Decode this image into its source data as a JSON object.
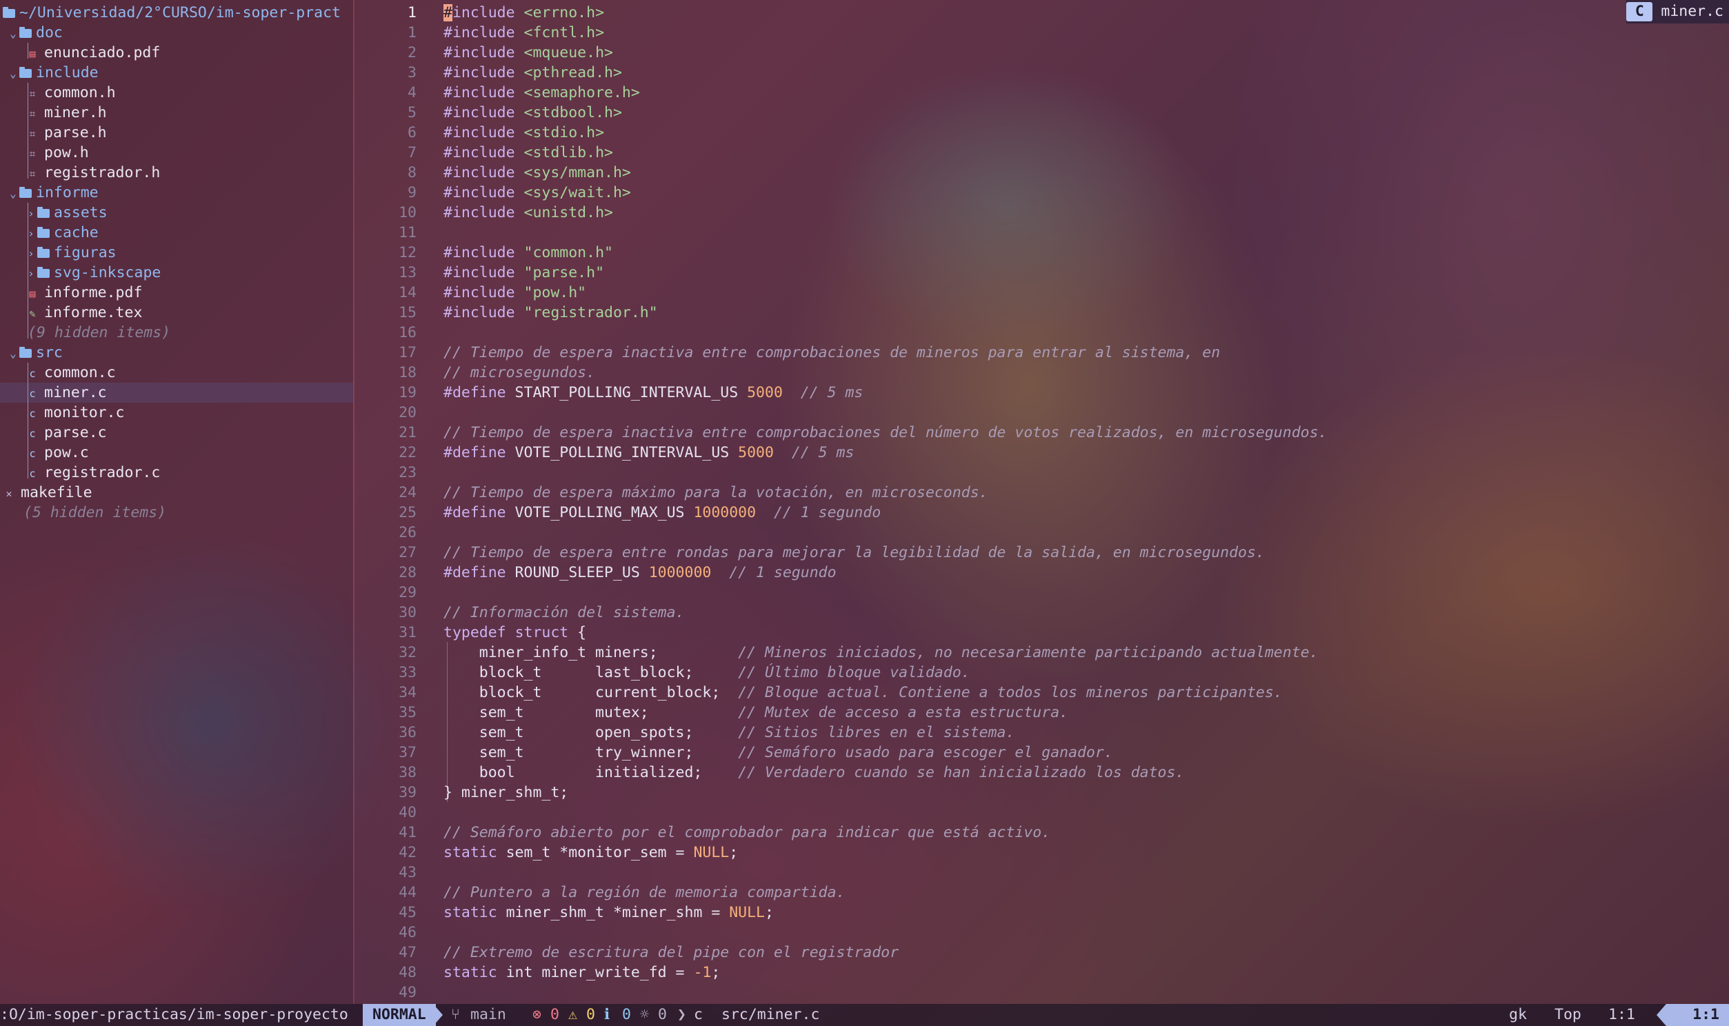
{
  "sidebar": {
    "root_path": "~/Universidad/2°CURSO/im-soper-pract",
    "items": [
      {
        "label": "doc",
        "kind": "dir",
        "open": true
      },
      {
        "label": "enunciado.pdf",
        "kind": "pdf"
      },
      {
        "label": "include",
        "kind": "dir",
        "open": true
      },
      {
        "label": "common.h",
        "kind": "header"
      },
      {
        "label": "miner.h",
        "kind": "header"
      },
      {
        "label": "parse.h",
        "kind": "header"
      },
      {
        "label": "pow.h",
        "kind": "header"
      },
      {
        "label": "registrador.h",
        "kind": "header"
      },
      {
        "label": "informe",
        "kind": "dir",
        "open": true
      },
      {
        "label": "assets",
        "kind": "dir",
        "open": false
      },
      {
        "label": "cache",
        "kind": "dir",
        "open": false
      },
      {
        "label": "figuras",
        "kind": "dir",
        "open": false
      },
      {
        "label": "svg-inkscape",
        "kind": "dir",
        "open": false
      },
      {
        "label": "informe.pdf",
        "kind": "pdf"
      },
      {
        "label": "informe.tex",
        "kind": "tex"
      },
      {
        "label": "(9 hidden items)",
        "kind": "hidden"
      },
      {
        "label": "src",
        "kind": "dir",
        "open": true
      },
      {
        "label": "common.c",
        "kind": "c"
      },
      {
        "label": "miner.c",
        "kind": "c",
        "selected": true
      },
      {
        "label": "monitor.c",
        "kind": "c"
      },
      {
        "label": "parse.c",
        "kind": "c"
      },
      {
        "label": "pow.c",
        "kind": "c"
      },
      {
        "label": "registrador.c",
        "kind": "c"
      },
      {
        "label": "makefile",
        "kind": "makefile"
      },
      {
        "label": "(5 hidden items)",
        "kind": "hidden"
      }
    ]
  },
  "tab": {
    "icon": "C",
    "name": "miner.c"
  },
  "line_numbers": [
    "1",
    "1",
    "2",
    "3",
    "4",
    "5",
    "6",
    "7",
    "8",
    "9",
    "10",
    "11",
    "12",
    "13",
    "14",
    "15",
    "16",
    "17",
    "18",
    "19",
    "20",
    "21",
    "22",
    "23",
    "24",
    "25",
    "26",
    "27",
    "28",
    "29",
    "30",
    "31",
    "32",
    "33",
    "34",
    "35",
    "36",
    "37",
    "38",
    "39",
    "40",
    "41",
    "42",
    "43",
    "44",
    "45",
    "46",
    "47",
    "48",
    "49"
  ],
  "code_lines": [
    "#include <errno.h>",
    "#include <fcntl.h>",
    "#include <mqueue.h>",
    "#include <pthread.h>",
    "#include <semaphore.h>",
    "#include <stdbool.h>",
    "#include <stdio.h>",
    "#include <stdlib.h>",
    "#include <sys/mman.h>",
    "#include <sys/wait.h>",
    "#include <unistd.h>",
    "",
    "#include \"common.h\"",
    "#include \"parse.h\"",
    "#include \"pow.h\"",
    "#include \"registrador.h\"",
    "",
    "// Tiempo de espera inactiva entre comprobaciones de mineros para entrar al sistema, en",
    "// microsegundos.",
    "#define START_POLLING_INTERVAL_US 5000  // 5 ms",
    "",
    "// Tiempo de espera inactiva entre comprobaciones del número de votos realizados, en microsegundos.",
    "#define VOTE_POLLING_INTERVAL_US 5000  // 5 ms",
    "",
    "// Tiempo de espera máximo para la votación, en microseconds.",
    "#define VOTE_POLLING_MAX_US 1000000  // 1 segundo",
    "",
    "// Tiempo de espera entre rondas para mejorar la legibilidad de la salida, en microsegundos.",
    "#define ROUND_SLEEP_US 1000000  // 1 segundo",
    "",
    "// Información del sistema.",
    "typedef struct {",
    "    miner_info_t miners;         // Mineros iniciados, no necesariamente participando actualmente.",
    "    block_t      last_block;     // Último bloque validado.",
    "    block_t      current_block;  // Bloque actual. Contiene a todos los mineros participantes.",
    "    sem_t        mutex;          // Mutex de acceso a esta estructura.",
    "    sem_t        open_spots;     // Sitios libres en el sistema.",
    "    sem_t        try_winner;     // Semáforo usado para escoger el ganador.",
    "    bool         initialized;    // Verdadero cuando se han inicializado los datos.",
    "} miner_shm_t;",
    "",
    "// Semáforo abierto por el comprobador para indicar que está activo.",
    "static sem_t *monitor_sem = NULL;",
    "",
    "// Puntero a la región de memoria compartida.",
    "static miner_shm_t *miner_shm = NULL;",
    "",
    "// Extremo de escritura del pipe con el registrador",
    "static int miner_write_fd = -1;",
    ""
  ],
  "statusbar": {
    "cwd": ":O/im-soper-practicas/im-soper-proyecto",
    "mode": "NORMAL",
    "branch": "main",
    "errors": "0",
    "warnings": "0",
    "info": "0",
    "hints": "0",
    "filetype": "c",
    "file": "src/miner.c",
    "keys": "gk",
    "scroll": "Top",
    "position": "1:1",
    "location": "1:1"
  },
  "colors": {
    "accent": "#a9b8e8",
    "directory": "#8fb8ef",
    "string": "#a6d29a",
    "number": "#f5b17c",
    "keyword": "#cbb2f0",
    "comment": "#a89cb6"
  }
}
